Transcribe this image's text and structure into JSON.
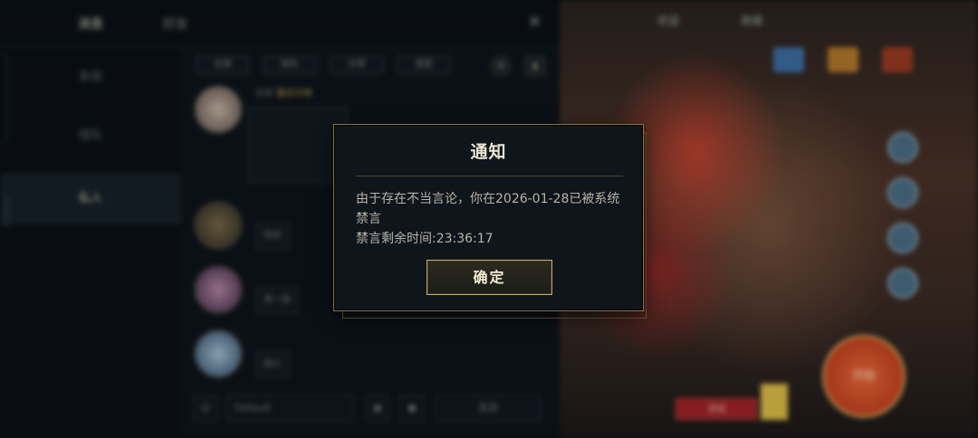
{
  "chat": {
    "tabs": [
      {
        "label": "消息",
        "active": true
      },
      {
        "label": "好友",
        "active": false
      }
    ],
    "left_items": [
      {
        "label": "系统"
      },
      {
        "label": "组队"
      },
      {
        "label": "私人"
      }
    ],
    "side_text": "9F00652",
    "filters": [
      "全部",
      "组队",
      "分享",
      "语音"
    ],
    "messages": [
      {
        "name": "玩家",
        "highlight": "最近对局",
        "bubble": "战绩分享"
      },
      {
        "name": "玩家",
        "highlight": "",
        "bubble": "你好"
      },
      {
        "name": "玩家",
        "highlight": "",
        "bubble": "来一局"
      },
      {
        "name": "玩家",
        "highlight": "",
        "bubble": "加入"
      }
    ],
    "bottom": {
      "input": "Default",
      "send": "发送"
    }
  },
  "art": {
    "top_items": [
      "欢迎",
      "商城"
    ],
    "play_label": "开始",
    "label": "活动"
  },
  "modal": {
    "title": "通知",
    "body_line1": "由于存在不当言论，你在2026-01-28已被系统",
    "body_line2": "禁言",
    "body_line3": "禁言剩余时间:23:36:17",
    "confirm_label": "确定"
  },
  "colors": {
    "gold_border": "#8a7440",
    "button_border": "#c8aa6e",
    "modal_bg": "#0e151b",
    "title_text": "#ece5d2"
  },
  "icons": [
    "close-icon",
    "settings-icon",
    "trash-icon"
  ]
}
